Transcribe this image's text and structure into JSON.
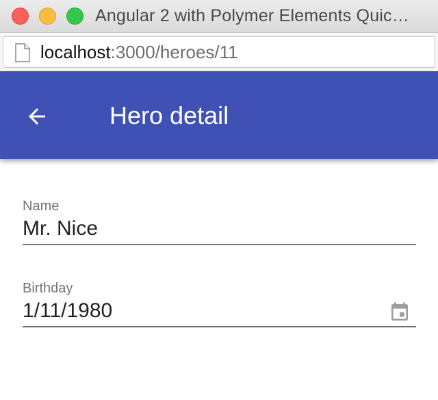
{
  "window": {
    "title": "Angular 2 with Polymer Elements Quic…"
  },
  "address_bar": {
    "host": "localhost",
    "path": ":3000/heroes/11",
    "page_icon": "page-icon"
  },
  "toolbar": {
    "back_icon": "arrow-back-icon",
    "title": "Hero detail",
    "color": "#3f51b5"
  },
  "form": {
    "name": {
      "label": "Name",
      "value": "Mr. Nice"
    },
    "birthday": {
      "label": "Birthday",
      "value": "1/11/1980",
      "icon": "calendar-icon"
    }
  }
}
